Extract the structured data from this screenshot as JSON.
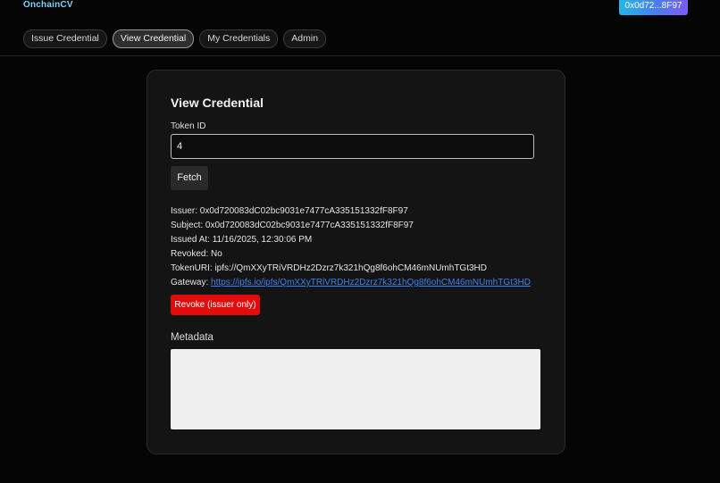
{
  "header": {
    "brand": "OnchainCV",
    "wallet": "0x0d72...8F97"
  },
  "nav": {
    "tabs": [
      {
        "label": "Issue Credential",
        "active": false
      },
      {
        "label": "View Credential",
        "active": true
      },
      {
        "label": "My Credentials",
        "active": false
      },
      {
        "label": "Admin",
        "active": false
      }
    ]
  },
  "card": {
    "title": "View Credential",
    "token_label": "Token ID",
    "token_value": "4",
    "fetch_label": "Fetch",
    "details": {
      "issuer": "Issuer: 0x0d720083dC02bc9031e7477cA335151332fF8F97",
      "subject": "Subject: 0x0d720083dC02bc9031e7477cA335151332fF8F97",
      "issued_at": "Issued At: 11/16/2025, 12:30:06 PM",
      "revoked": "Revoked: No",
      "token_uri": "TokenURI: ipfs://QmXXyTRiVRDHz2Dzrz7k321hQg8f6ohCM46mNUmhTGt3HD",
      "gateway_label": "Gateway: ",
      "gateway_link": "https://ipfs.io/ipfs/QmXXyTRiVRDHz2Dzrz7k321hQg8f6ohCM46mNUmhTGt3HD"
    },
    "revoke_label": "Revoke (issuer only)",
    "metadata_title": "Metadata"
  },
  "colors": {
    "accent_gradient": [
      "#22b8e8",
      "#7b5cf2"
    ],
    "danger": "#e00c0c",
    "link": "#3b82f6"
  }
}
